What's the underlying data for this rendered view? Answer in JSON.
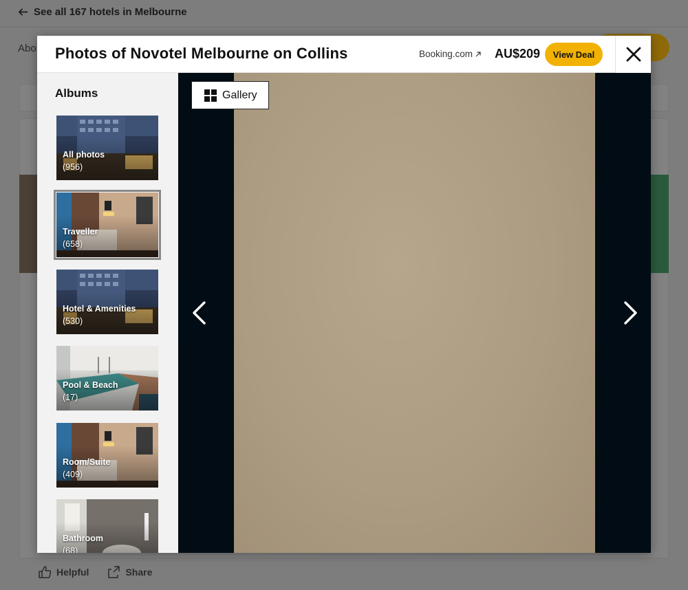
{
  "background": {
    "back_link": "See all 167 hotels in Melbourne",
    "tab_partial": "Abo",
    "actions": {
      "helpful": "Helpful",
      "share": "Share"
    }
  },
  "modal": {
    "title": "Photos of Novotel Melbourne on Collins",
    "provider": "Booking.com",
    "price": "AU$209",
    "view_deal": "View Deal"
  },
  "albums": {
    "heading": "Albums",
    "items": [
      {
        "label": "All photos",
        "count": "(956)",
        "selected": false
      },
      {
        "label": "Traveller",
        "count": "(658)",
        "selected": true
      },
      {
        "label": "Hotel & Amenities",
        "count": "(530)",
        "selected": false
      },
      {
        "label": "Pool & Beach",
        "count": "(17)",
        "selected": false
      },
      {
        "label": "Room/Suite",
        "count": "(409)",
        "selected": false
      },
      {
        "label": "Bathroom",
        "count": "(68)",
        "selected": false
      }
    ]
  },
  "viewer": {
    "gallery_label": "Gallery"
  },
  "icons": {
    "back": "arrow-left-icon",
    "external": "external-link-icon",
    "close": "close-icon",
    "gallery": "grid-icon",
    "prev": "chevron-left-icon",
    "next": "chevron-right-icon",
    "helpful": "thumbs-up-icon",
    "share": "share-icon"
  },
  "colors": {
    "accent_yellow": "#f2b203",
    "viewer_bg": "#020c14"
  }
}
